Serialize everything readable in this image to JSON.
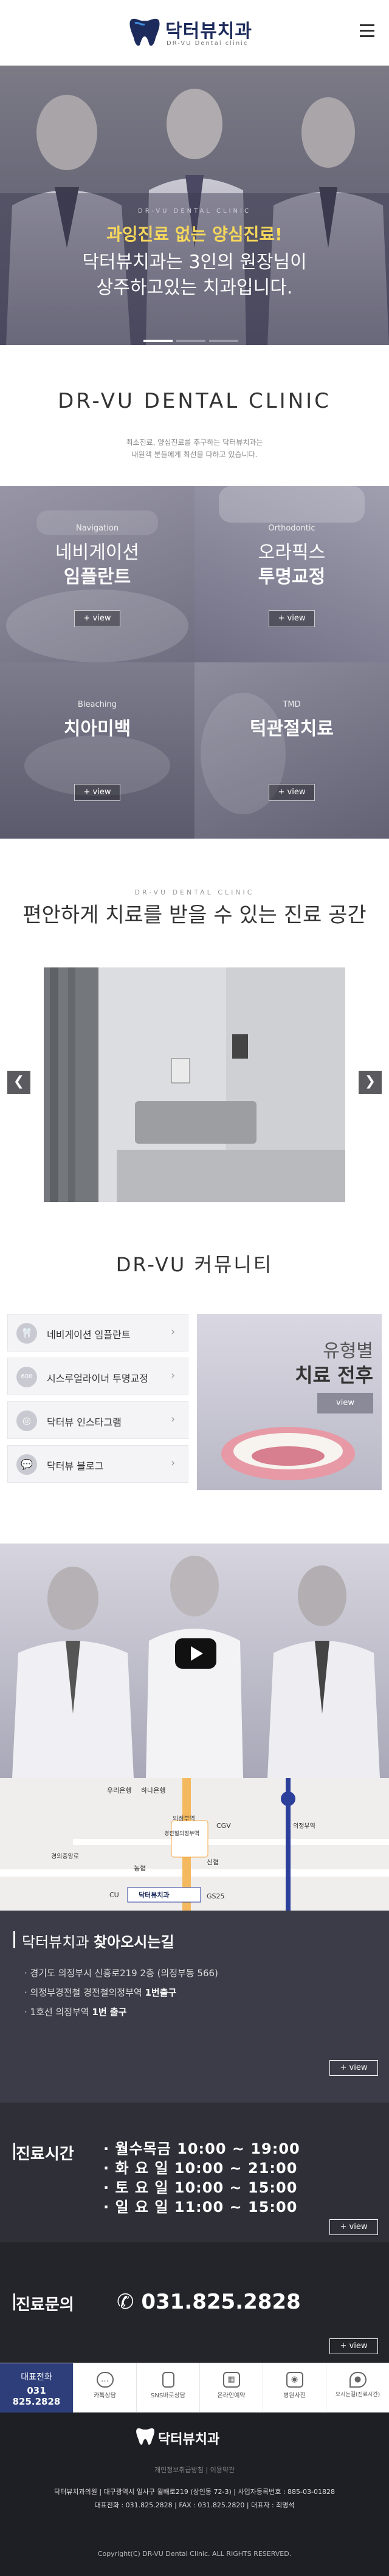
{
  "header": {
    "logo_text": "닥터뷰치과",
    "logo_mark_text": "VU",
    "logo_en": "DR-VU Dental clinic"
  },
  "hero": {
    "sub": "DR-VU DENTAL CLINIC",
    "line1": "과잉진료 없는 양심진료!",
    "line2": "닥터뷰치과는 3인의 원장님이",
    "line3": "상주하고있는 치과입니다.",
    "slides": 3,
    "active_slide": 1
  },
  "clinic": {
    "title": "DR-VU DENTAL CLINIC",
    "desc1": "최소진료, 양심진료를 추구하는 닥터뷰치과는",
    "desc2": "내원객 분들에게 최선을 다하고 있습니다.",
    "tiles": [
      {
        "category": "Navigation",
        "name1": "네비게이션",
        "name2": "임플란트",
        "button": "+ view"
      },
      {
        "category": "Orthodontic",
        "name1": "오라픽스",
        "name2": "투명교정",
        "button": "+ view"
      },
      {
        "category": "Bleaching",
        "name1": "치아미백",
        "name2": "",
        "button": "+ view"
      },
      {
        "category": "TMD",
        "name1": "턱관절치료",
        "name2": "",
        "button": "+ view"
      }
    ]
  },
  "space": {
    "sub": "DR-VU DENTAL CLINIC",
    "title": "편안하게 치료를 받을 수 있는 진료 공간",
    "prev": "❮",
    "next": "❯"
  },
  "community": {
    "title": "DR-VU 커뮤니티",
    "items": [
      {
        "label": "네비게이션 임플란트",
        "icon": "🦷"
      },
      {
        "label": "시스루얼라이너 투명교정",
        "icon": "600"
      },
      {
        "label": "닥터뷰 인스타그램",
        "icon": "◎"
      },
      {
        "label": "닥터뷰 블로그",
        "icon": "💬"
      }
    ],
    "chevron": "›",
    "case_t1": "유형별",
    "case_t2": "치료 전후",
    "case_button": "view"
  },
  "map": {
    "labels": [
      "우리은행",
      "하나은행",
      "의정부역",
      "경전철의정부역",
      "CGV",
      "신협",
      "농협",
      "CU",
      "GS25",
      "닥터뷰치과",
      "의정부역",
      "경의중앙로"
    ]
  },
  "location": {
    "title_pre": "닥터뷰치과",
    "title_bold": "찾아오시는길",
    "line1": "· 경기도 의정부시 신흥로219 2층 (의정부동 566)",
    "line2_pre": "· 의정부경전철 경전철의정부역 ",
    "line2_bold": "1번출구",
    "line3_pre": "· 1호선 의정부역 ",
    "line3_bold": "1번 출구",
    "button": "+ view"
  },
  "hours": {
    "title": "진료시간",
    "rows": [
      "· 월수목금   10:00 ~ 19:00",
      "· 화 요 일   10:00 ~ 21:00",
      "· 토 요 일   10:00 ~ 15:00",
      "· 일 요 일   11:00 ~ 15:00"
    ],
    "button": "+ view"
  },
  "contact": {
    "title": "진료문의",
    "phone_icon": "✆",
    "phone": "031.825.2828",
    "button": "+ view"
  },
  "quickbar": {
    "rep_label": "대표전화",
    "rep_phone": "031\n825.2828",
    "items": [
      {
        "label": "카톡상담",
        "icon": "talk"
      },
      {
        "label": "SNS바로상담",
        "icon": "sns"
      },
      {
        "label": "온라인예약",
        "icon": "cal"
      },
      {
        "label": "병원사진",
        "icon": "cam"
      },
      {
        "label": "오시는길(진료시간)",
        "icon": "map"
      }
    ]
  },
  "footer": {
    "logo": "닥터뷰치과",
    "links": "개인정보취급방침  |  이용약관",
    "info1": "닥터뷰치과의원   |   대구광역시 일사구 월배로219 (상인동 72-3)   |   사업자등록번호 : 885-03-01828",
    "info2": "대표전화 : 031.825.2828   |   FAX : 031.825.2820   |   대표자 : 최명석",
    "copy": "Copyright(C) DR-VU Dental Clinic. ALL RIGHTS RESERVED."
  }
}
